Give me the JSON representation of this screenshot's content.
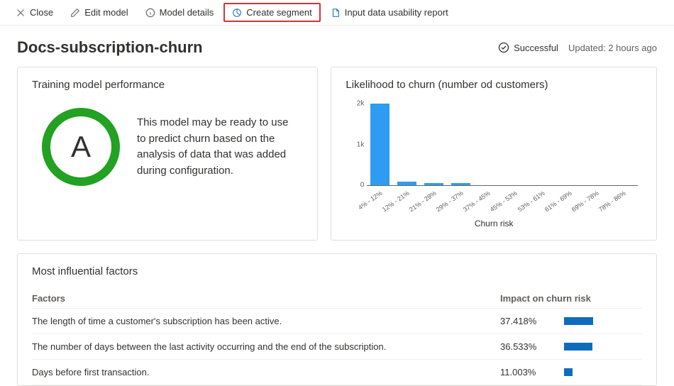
{
  "toolbar": {
    "close": "Close",
    "edit": "Edit model",
    "details": "Model details",
    "create_segment": "Create segment",
    "usability": "Input data usability report"
  },
  "header": {
    "title": "Docs-subscription-churn",
    "status": "Successful",
    "updated": "Updated: 2 hours ago"
  },
  "performance": {
    "title": "Training model performance",
    "grade": "A",
    "description": "This model may be ready to use to predict churn based on the analysis of data that was added during configuration."
  },
  "chart": {
    "title": "Likelihood to churn (number od customers)",
    "xlabel": "Churn risk"
  },
  "chart_data": {
    "type": "bar",
    "title": "Likelihood to churn (number od customers)",
    "xlabel": "Churn risk",
    "ylabel": "",
    "ylim": [
      0,
      2000
    ],
    "yticks": [
      0,
      1000,
      2000
    ],
    "ytick_labels": [
      "0",
      "1k",
      "2k"
    ],
    "categories": [
      "4% - 12%",
      "12% - 21%",
      "21% - 29%",
      "29% - 37%",
      "37% - 45%",
      "45% - 53%",
      "53% - 61%",
      "61% - 69%",
      "69% - 78%",
      "78% - 86%"
    ],
    "values": [
      2050,
      80,
      60,
      60,
      0,
      0,
      0,
      0,
      0,
      0
    ]
  },
  "factors": {
    "title": "Most influential factors",
    "col_name": "Factors",
    "col_impact": "Impact on churn risk",
    "rows": [
      {
        "name": "The length of time a customer's subscription has been active.",
        "impact": "37.418%",
        "bar_pct": 37.418
      },
      {
        "name": "The number of days between the last activity occurring and the end of the subscription.",
        "impact": "36.533%",
        "bar_pct": 36.533
      },
      {
        "name": "Days before first transaction.",
        "impact": "11.003%",
        "bar_pct": 11.003
      }
    ]
  }
}
